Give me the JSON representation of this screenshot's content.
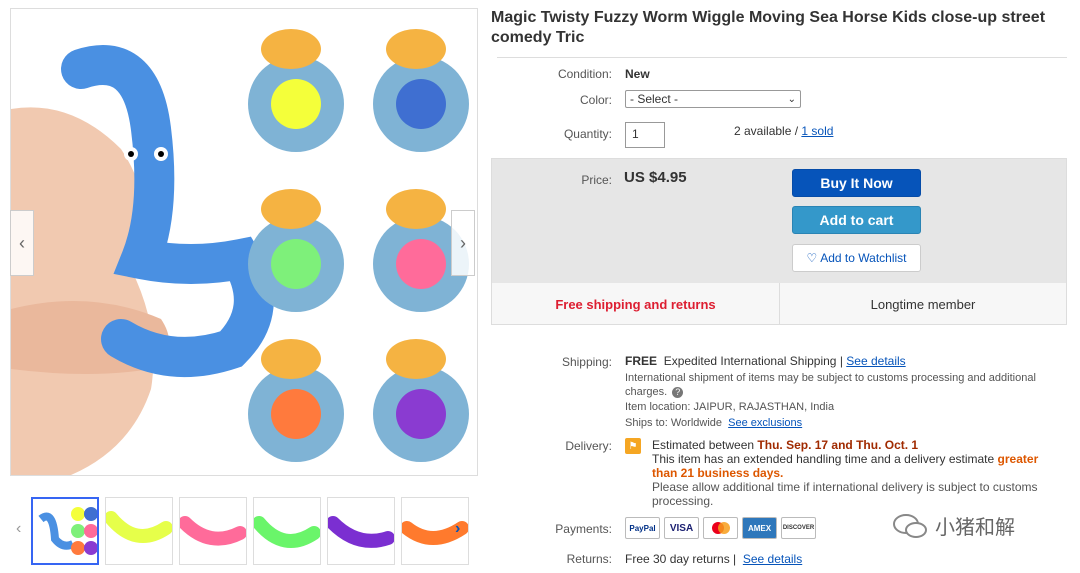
{
  "product": {
    "title": "Magic Twisty Fuzzy Worm Wiggle Moving Sea Horse Kids close-up street comedy Tric"
  },
  "details": {
    "condition_label": "Condition:",
    "condition_value": "New",
    "color_label": "Color:",
    "color_select": "- Select -",
    "quantity_label": "Quantity:",
    "quantity_value": "1",
    "available_text": "2 available /",
    "sold_link": "1 sold"
  },
  "buybox": {
    "price_label": "Price:",
    "price_value": "US $4.95",
    "buy_now": "Buy It Now",
    "add_to_cart": "Add to cart",
    "watchlist": "Add to Watchlist",
    "free_shipping": "Free shipping and returns",
    "longtime_member": "Longtime member"
  },
  "shipping": {
    "label": "Shipping:",
    "free": "FREE",
    "method": "Expedited International Shipping |",
    "see_details": "See details",
    "customs_note": "International shipment of items may be subject to customs processing and additional charges.",
    "location_label": "Item location:",
    "location_value": "JAIPUR, RAJASTHAN, India",
    "ships_label": "Ships to:",
    "ships_value": "Worldwide",
    "see_exclusions": "See exclusions"
  },
  "delivery": {
    "label": "Delivery:",
    "estimated_prefix": "Estimated between",
    "estimated_dates": "Thu. Sep. 17 and Thu. Oct. 1",
    "handling_text": "This item has an extended handling time and a delivery estimate",
    "handling_highlight": "greater than 21 business days.",
    "allow_note": "Please allow additional time if international delivery is subject to customs processing."
  },
  "payments": {
    "label": "Payments:",
    "logos": [
      "PayPal",
      "VISA",
      "MasterCard",
      "AMEX",
      "DISCOVER"
    ]
  },
  "returns": {
    "label": "Returns:",
    "text": "Free 30 day returns |",
    "see_details": "See details"
  },
  "watermark": {
    "text": "小猪和解"
  },
  "colors": {
    "buy_blue": "#0654ba",
    "cart_blue": "#3498ca",
    "free_red": "#dd1e31",
    "worm_blue": "#4a90e2"
  }
}
